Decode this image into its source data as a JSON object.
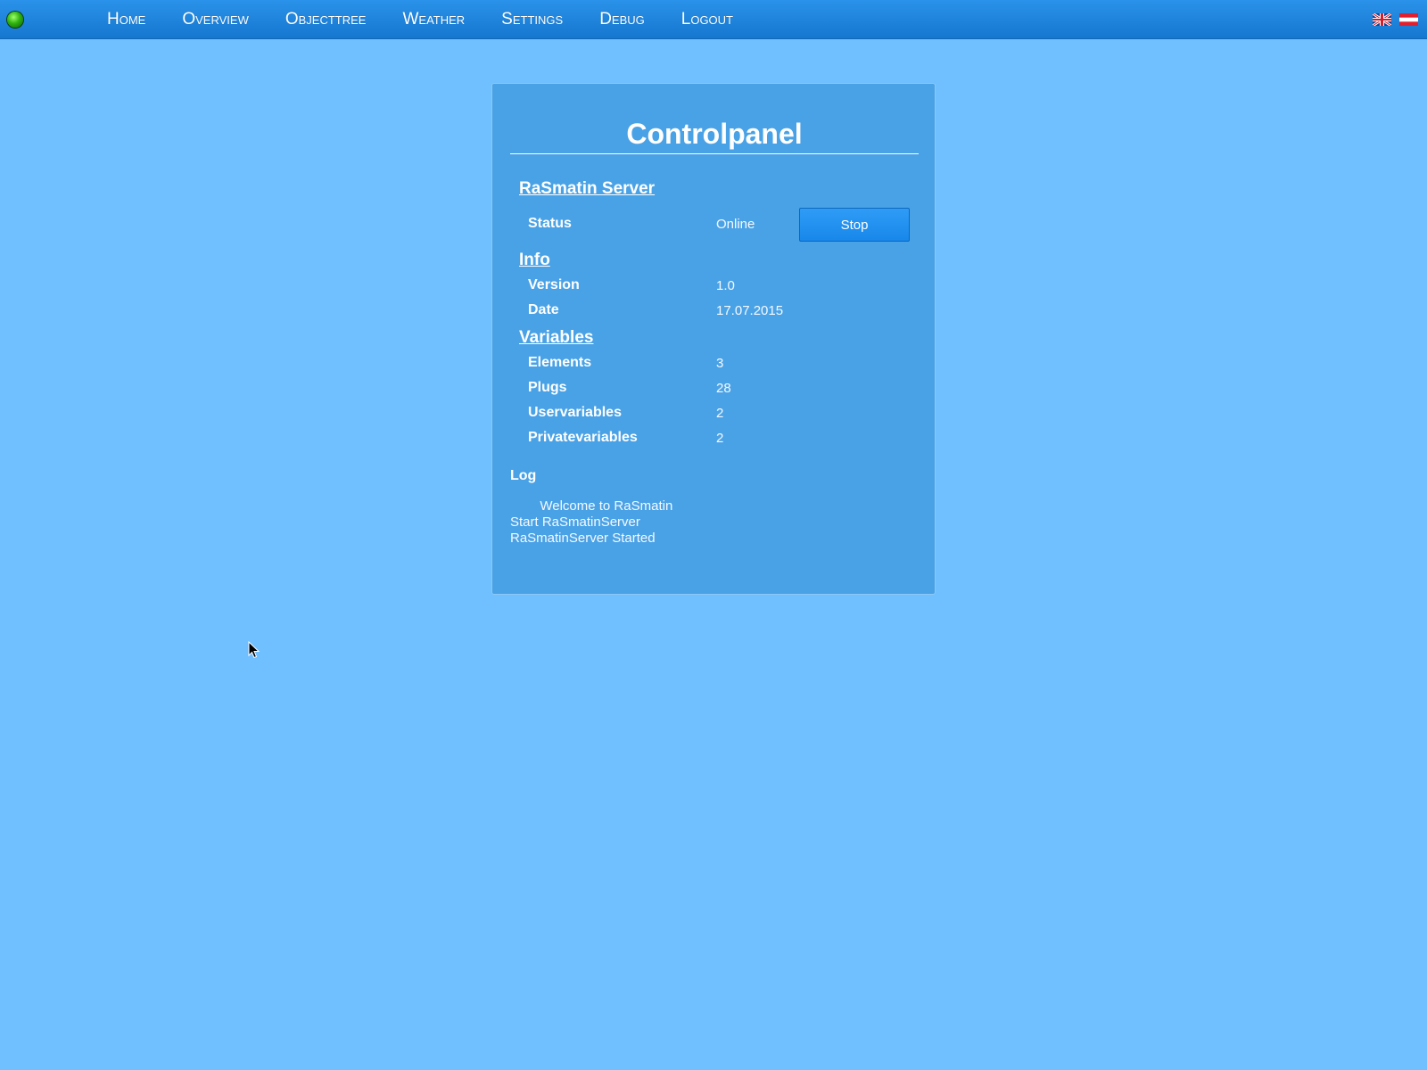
{
  "nav": {
    "items": [
      {
        "label": "Home"
      },
      {
        "label": "Overview"
      },
      {
        "label": "Objecttree"
      },
      {
        "label": "Weather"
      },
      {
        "label": "Settings"
      },
      {
        "label": "Debug"
      },
      {
        "label": "Logout"
      }
    ],
    "status_led_color": "#2fb210",
    "flags": [
      "uk-flag-icon",
      "austria-flag-icon"
    ]
  },
  "panel": {
    "title": "Controlpanel",
    "server": {
      "heading": "RaSmatin Server",
      "status_label": "Status",
      "status_value": "Online",
      "stop_label": "Stop"
    },
    "info": {
      "heading": "Info",
      "version_label": "Version",
      "version_value": "1.0",
      "date_label": "Date",
      "date_value": "17.07.2015"
    },
    "variables": {
      "heading": "Variables",
      "elements_label": "Elements",
      "elements_value": "3",
      "plugs_label": "Plugs",
      "plugs_value": "28",
      "uservariables_label": "Uservariables",
      "uservariables_value": "2",
      "privatevariables_label": "Privatevariables",
      "privatevariables_value": "2"
    },
    "log": {
      "label": "Log",
      "lines": [
        "        Welcome to RaSmatin",
        "Start RaSmatinServer",
        "RaSmatinServer Started"
      ]
    }
  },
  "colors": {
    "background": "#70bfff",
    "topbar": "#1f85dd",
    "panel": "#4aa2e6",
    "button": "#1f8ff0"
  }
}
